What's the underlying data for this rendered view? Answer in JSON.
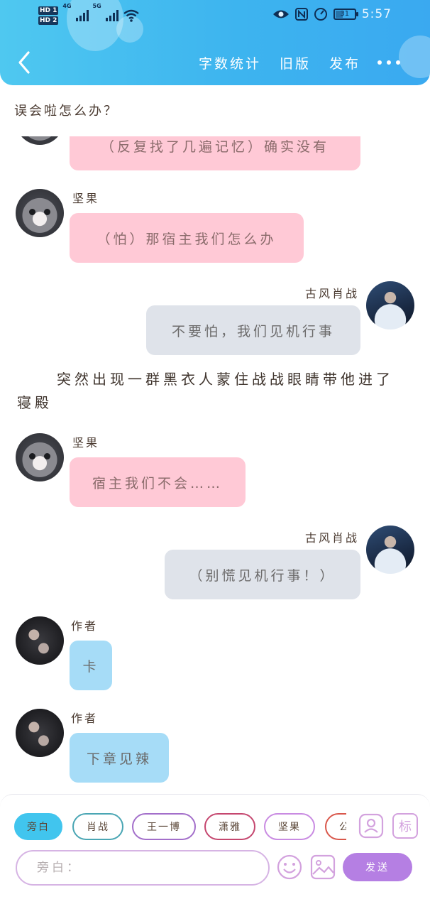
{
  "status_bar": {
    "hd1": "HD 1",
    "hd2": "HD 2",
    "net1": "4G",
    "net2": "5G",
    "battery": "31",
    "time": "5:57"
  },
  "header": {
    "menu": [
      "字数统计",
      "旧版",
      "发布"
    ]
  },
  "top_text": "误会啦怎么办？",
  "messages": {
    "m1": {
      "text": "（反复找了几遍记忆）确实没有"
    },
    "m2": {
      "name": "坚果",
      "text": "（怕）那宿主我们怎么办"
    },
    "m3": {
      "name": "古风肖战",
      "text": "不要怕，我们见机行事"
    },
    "narration": "突然出现一群黑衣人蒙住战战眼睛带他进了寝殿",
    "m4": {
      "name": "坚果",
      "text": "宿主我们不会……"
    },
    "m5": {
      "name": "古风肖战",
      "text": "（别慌见机行事！）"
    },
    "m6": {
      "name": "作者",
      "text": "卡"
    },
    "m7": {
      "name": "作者",
      "text": "下章见辣"
    }
  },
  "input_bar": {
    "chips": [
      {
        "label": "旁白",
        "color": "#41c5ee"
      },
      {
        "label": "肖战",
        "color": "#4aa6b4"
      },
      {
        "label": "王一博",
        "color": "#a36fca"
      },
      {
        "label": "潇雅",
        "color": "#c5476f"
      },
      {
        "label": "坚果",
        "color": "#c98be2"
      },
      {
        "label": "公",
        "color": "#d9574b"
      }
    ],
    "role_icon": "role-card-icon",
    "tag_icon_label": "标",
    "placeholder": "旁白：",
    "emoji_icon": "smile-icon",
    "image_icon": "image-icon",
    "send_label": "发送",
    "accent": "#b57fe3"
  }
}
